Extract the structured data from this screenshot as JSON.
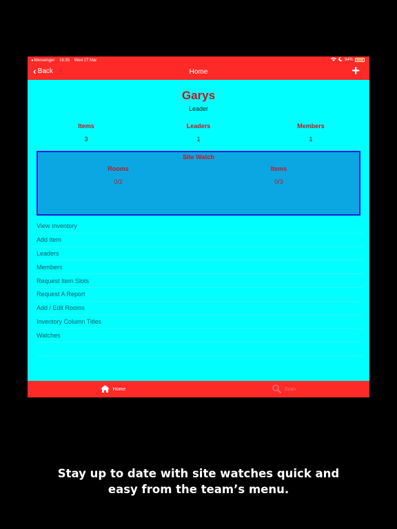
{
  "status_bar": {
    "carrier": "◂ Messenger",
    "time": "16:35",
    "date": "Wed 27 Mar",
    "battery": "94%"
  },
  "nav": {
    "back_label": "Back",
    "title": "Home",
    "add_label": "+"
  },
  "team": {
    "name": "Garys",
    "role": "Leader"
  },
  "stats": [
    {
      "label": "Items",
      "value": "3"
    },
    {
      "label": "Leaders",
      "value": "1"
    },
    {
      "label": "Members",
      "value": "1"
    }
  ],
  "site_watch": {
    "title": "Site Watch",
    "columns": [
      {
        "label": "Rooms",
        "value": "0/2"
      },
      {
        "label": "Items",
        "value": "0/3"
      }
    ]
  },
  "menu": [
    "View Inventory",
    "Add Item",
    "Leaders",
    "Members",
    "Request Item Slots",
    "Request A Report",
    "Add / Edit Rooms",
    "Inventory Column Titles",
    "Watches"
  ],
  "tabs": [
    {
      "label": "Home",
      "icon": "home-icon",
      "active": true
    },
    {
      "label": "Scan",
      "icon": "search-icon",
      "active": false
    }
  ],
  "caption": {
    "line1": "Stay up to date with site watches quick and",
    "line2": "easy from the team’s menu."
  },
  "colors": {
    "accent_red": "#fe2a28",
    "background_cyan": "#00ffff",
    "site_watch_blue": "#0aa7e3",
    "site_watch_border": "#1b1bd6",
    "label_red": "#c9151e"
  }
}
